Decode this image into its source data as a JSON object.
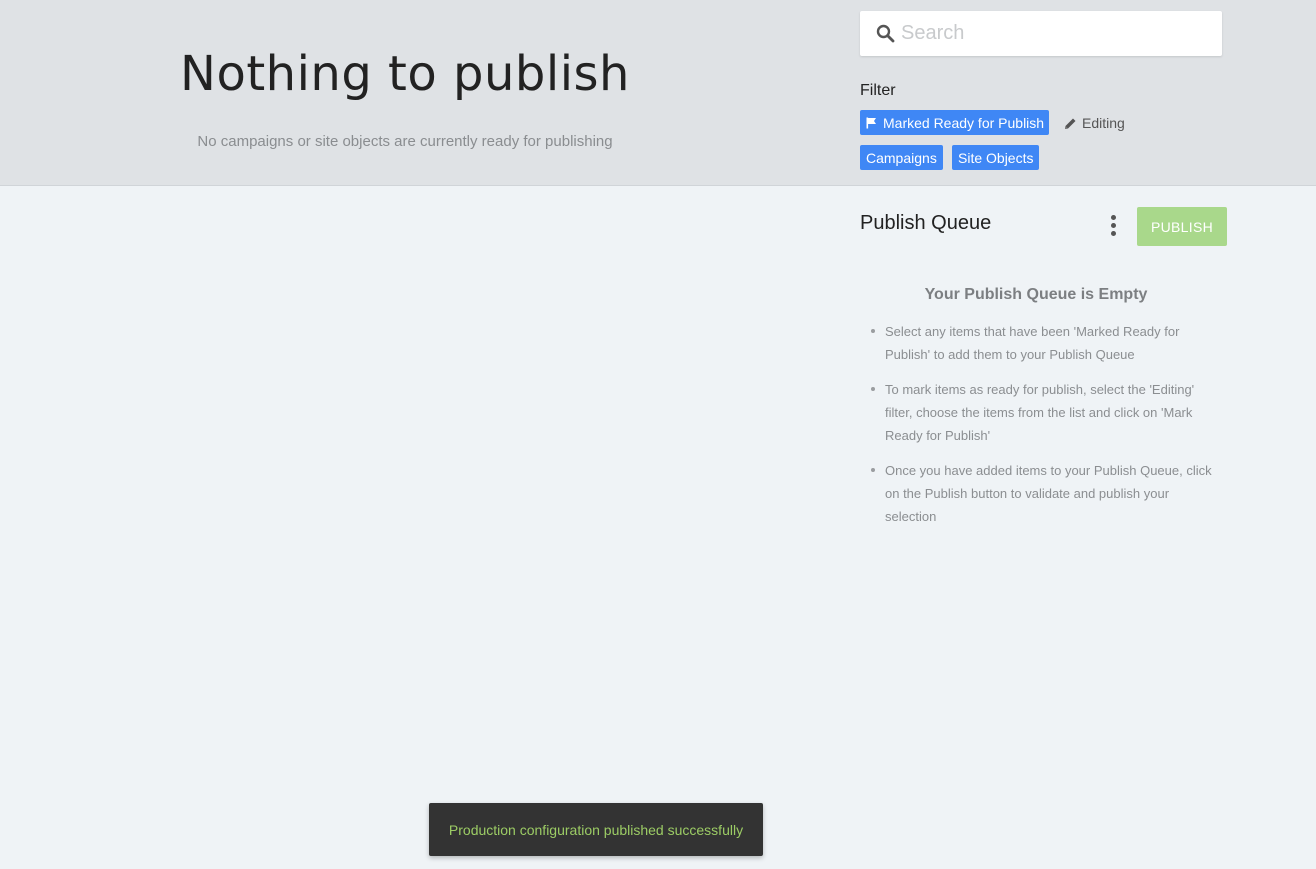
{
  "empty_state": {
    "title": "Nothing to publish",
    "subtitle": "No campaigns or site objects are currently ready for publishing"
  },
  "search": {
    "placeholder": "Search",
    "icon": "search-icon"
  },
  "filter": {
    "label": "Filter",
    "chips": {
      "marked_ready": "Marked Ready for Publish",
      "editing": "Editing",
      "campaigns": "Campaigns",
      "site_objects": "Site Objects"
    },
    "active_color": "#3f87f5"
  },
  "publish_queue": {
    "title": "Publish Queue",
    "publish_button": "PUBLISH",
    "publish_button_color": "#a9d88b",
    "empty_title": "Your Publish Queue is Empty",
    "help_items": [
      "Select any items that have been 'Marked Ready for Publish' to add them to your Publish Queue",
      "To mark items as ready for publish, select the 'Editing' filter, choose the items from the list and click on 'Mark Ready for Publish'",
      "Once you have added items to your Publish Queue, click on the Publish button to validate and publish your selection"
    ]
  },
  "toast": {
    "message": "Production configuration published successfully",
    "text_color": "#9ccc65"
  }
}
